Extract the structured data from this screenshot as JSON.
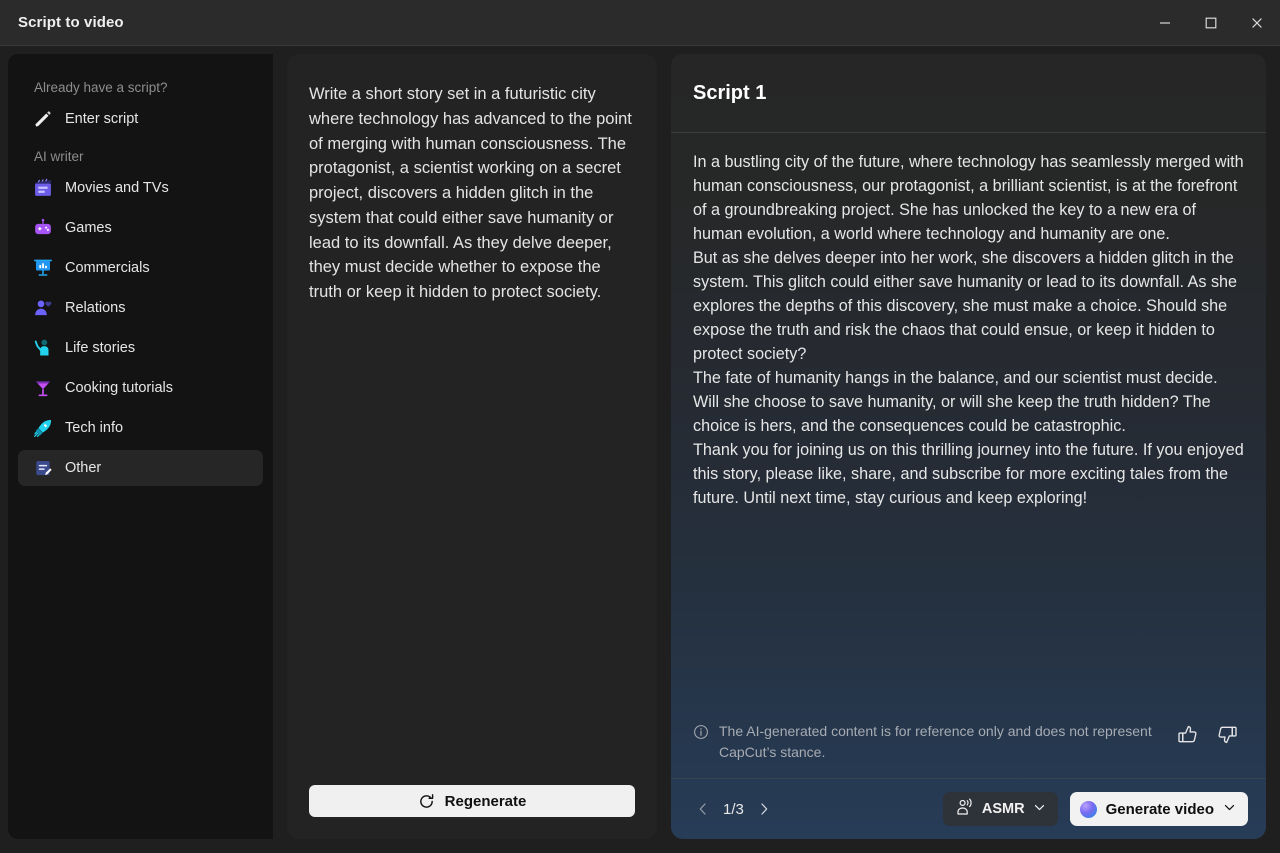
{
  "window": {
    "title": "Script to video",
    "controls": {
      "minimize": "minimize-icon",
      "maximize": "maximize-icon",
      "close": "close-icon"
    }
  },
  "sidebar": {
    "groups": [
      {
        "label": "Already have a script?",
        "items": [
          {
            "label": "Enter script",
            "icon": "pencil-icon",
            "active": false
          }
        ]
      },
      {
        "label": "AI writer",
        "items": [
          {
            "label": "Movies and TVs",
            "icon": "clapperboard-icon",
            "active": false
          },
          {
            "label": "Games",
            "icon": "gamepad-icon",
            "active": false
          },
          {
            "label": "Commercials",
            "icon": "presentation-chart-icon",
            "active": false
          },
          {
            "label": "Relations",
            "icon": "person-heart-icon",
            "active": false
          },
          {
            "label": "Life stories",
            "icon": "person-waving-icon",
            "active": false
          },
          {
            "label": "Cooking tutorials",
            "icon": "cocktail-glass-icon",
            "active": false
          },
          {
            "label": "Tech info",
            "icon": "rocket-icon",
            "active": false
          },
          {
            "label": "Other",
            "icon": "document-lines-icon",
            "active": true
          }
        ]
      }
    ]
  },
  "prompt_panel": {
    "text": "Write a short story set in a futuristic city where technology has advanced to the point of merging with human consciousness. The protagonist, a scientist working on a secret project, discovers a hidden glitch in the system that could either save humanity or lead to its downfall. As they delve deeper, they must decide whether to expose the truth or keep it hidden to protect society.",
    "regenerate_label": "Regenerate",
    "regenerate_icon": "refresh-icon"
  },
  "script_panel": {
    "title": "Script 1",
    "paragraphs": [
      "In a bustling city of the future, where technology has seamlessly merged with human consciousness, our protagonist, a brilliant scientist, is at the forefront of a groundbreaking project. She has unlocked the key to a new era of human evolution, a world where technology and humanity are one.",
      "But as she delves deeper into her work, she discovers a hidden glitch in the system. This glitch could either save humanity or lead to its downfall. As she explores the depths of this discovery, she must make a choice. Should she expose the truth and risk the chaos that could ensue, or keep it hidden to protect society?",
      "The fate of humanity hangs in the balance, and our scientist must decide. Will she choose to save humanity, or will she keep the truth hidden? The choice is hers, and the consequences could be catastrophic.",
      "Thank you for joining us on this thrilling journey into the future. If you enjoyed this story, please like, share, and subscribe for more exciting tales from the future. Until next time, stay curious and keep exploring!"
    ],
    "disclaimer": "The AI-generated content is for reference only and does not represent CapCut’s stance.",
    "disclaimer_icon": "info-circle-icon",
    "thumbs_up_icon": "thumbs-up-icon",
    "thumbs_down_icon": "thumbs-down-icon",
    "pager": {
      "prev_icon": "chevron-left-icon",
      "next_icon": "chevron-right-icon",
      "count": "1/3"
    },
    "voice_button": {
      "label": "ASMR",
      "icon": "voice-person-icon",
      "chevron": "chevron-down-icon"
    },
    "generate_button": {
      "label": "Generate video",
      "icon": "ai-orb-icon",
      "chevron": "chevron-down-icon"
    }
  },
  "colors": {
    "window_bg": "#1f1f1f",
    "titlebar_bg": "#2b2b2b",
    "sidebar_bg": "#131313",
    "mid_panel_bg": "#232323",
    "right_panel_top": "#262626",
    "right_panel_bottom": "#273c57",
    "accent_button": "#f2f2f2",
    "active_item_bg": "#262626"
  }
}
